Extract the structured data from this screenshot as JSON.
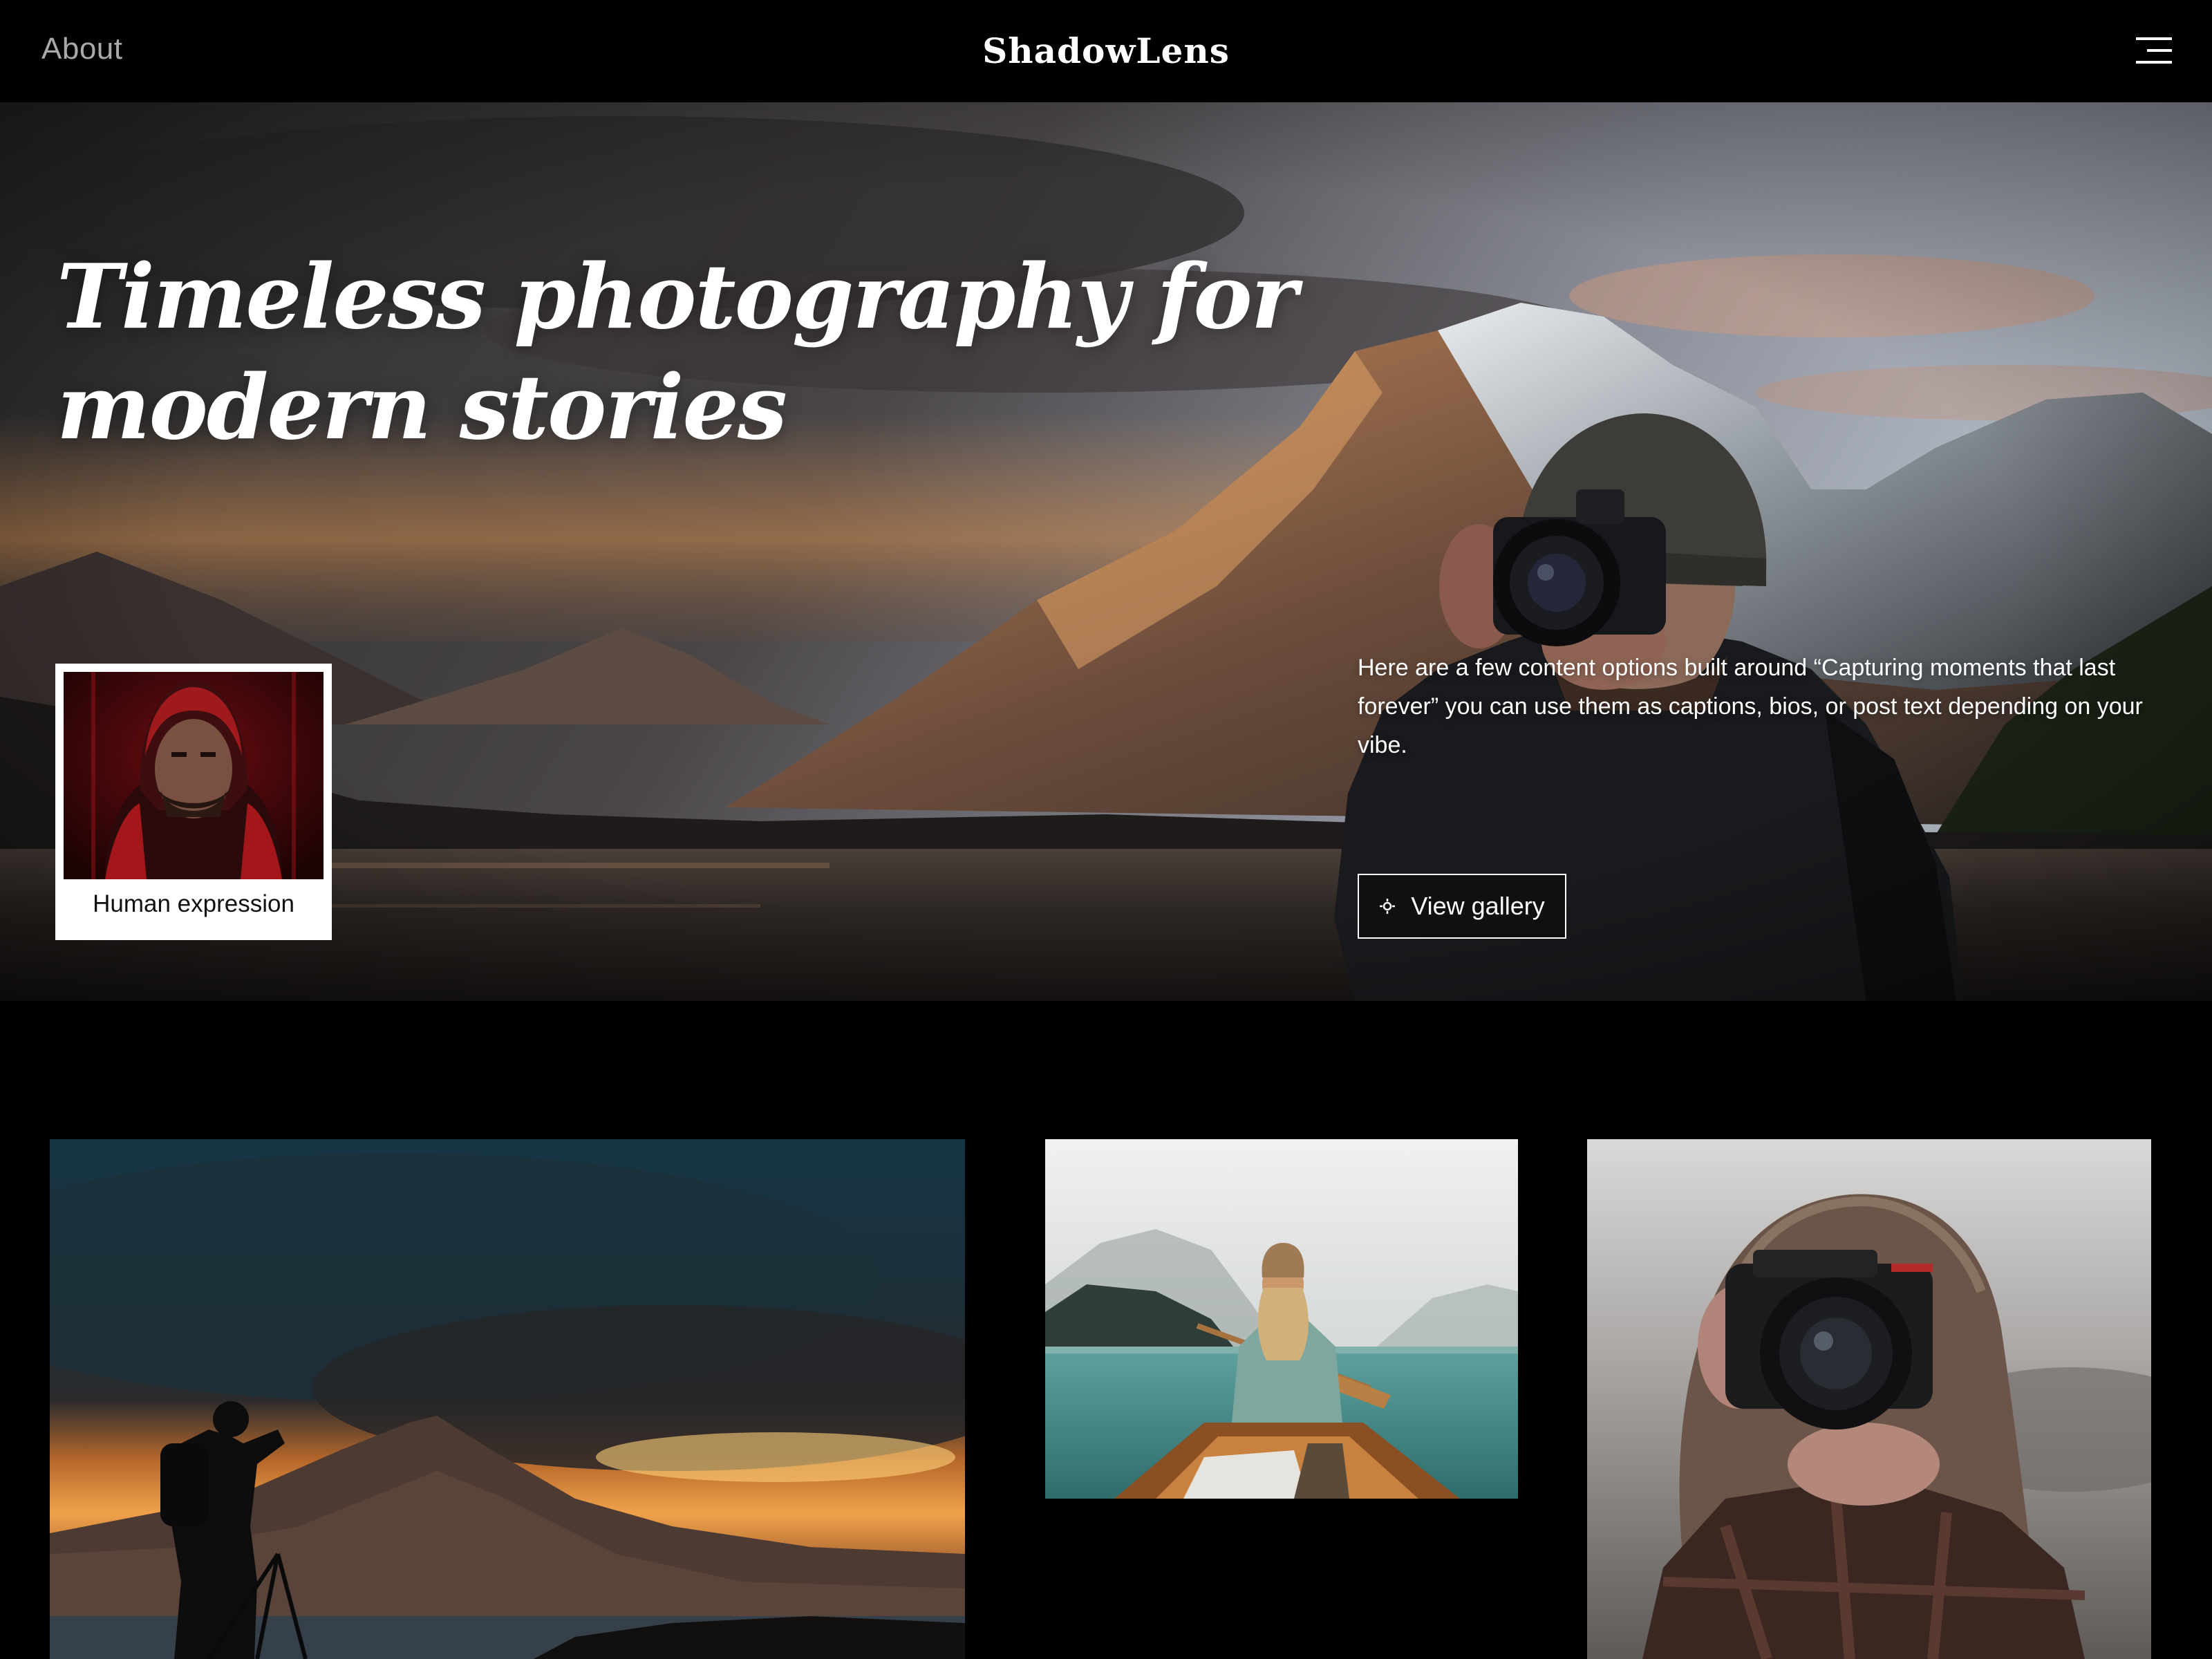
{
  "header": {
    "about_label": "About",
    "brand": "ShadowLens",
    "menu_icon": "hamburger-menu-icon"
  },
  "hero": {
    "title_line1": "Timeless photography for",
    "title_line2": "modern stories",
    "card_caption": "Human expression",
    "description": "Here are a few content options built around “Capturing moments that last forever” you can use them as captions, bios, or post text depending on your vibe.",
    "cta_label": "View gallery",
    "cta_icon": "sun-icon"
  },
  "colors": {
    "background": "#000000",
    "text": "#ffffff",
    "muted_text": "#a9a9a9",
    "card_background": "#ffffff"
  }
}
